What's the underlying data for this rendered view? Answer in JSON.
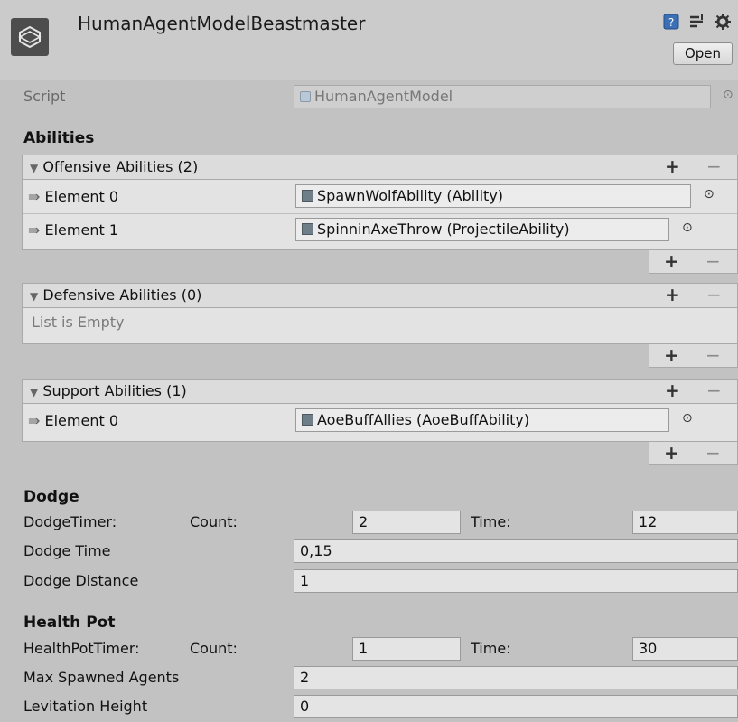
{
  "header": {
    "title": "HumanAgentModelBeastmaster",
    "open_label": "Open",
    "icons": [
      "unity-logo-icon",
      "help-book-icon",
      "presets-icon",
      "gear-icon"
    ]
  },
  "script": {
    "label": "Script",
    "value": "HumanAgentModel"
  },
  "abilities": {
    "section_title": "Abilities",
    "offensive": {
      "header": "Offensive Abilities (2)",
      "elements": [
        {
          "label": "Element 0",
          "value": "SpawnWolfAbility (Ability)"
        },
        {
          "label": "Element 1",
          "value": "SpinninAxeThrow (ProjectileAbility)"
        }
      ]
    },
    "defensive": {
      "header": "Defensive Abilities (0)",
      "empty_text": "List is Empty"
    },
    "support": {
      "header": "Support Abilities (1)",
      "elements": [
        {
          "label": "Element 0",
          "value": "AoeBuffAllies (AoeBuffAbility)"
        }
      ]
    },
    "add_glyph": "+",
    "remove_glyph": "−"
  },
  "dodge": {
    "section_title": "Dodge",
    "timer_label": "DodgeTimer:",
    "count_label": "Count:",
    "count_value": "2",
    "time_label": "Time:",
    "time_value": "12",
    "dodge_time_label": "Dodge Time",
    "dodge_time_value": "0,15",
    "dodge_distance_label": "Dodge Distance",
    "dodge_distance_value": "1"
  },
  "health_pot": {
    "section_title": "Health Pot",
    "timer_label": "HealthPotTimer:",
    "count_label": "Count:",
    "count_value": "1",
    "time_label": "Time:",
    "time_value": "30",
    "max_spawned_label": "Max Spawned Agents",
    "max_spawned_value": "2",
    "levitation_label": "Levitation Height",
    "levitation_value": "0"
  },
  "colors": {
    "panel_bg": "#c2c2c2",
    "field_bg": "#e4e4e4",
    "list_bg": "#e3e3e3"
  }
}
